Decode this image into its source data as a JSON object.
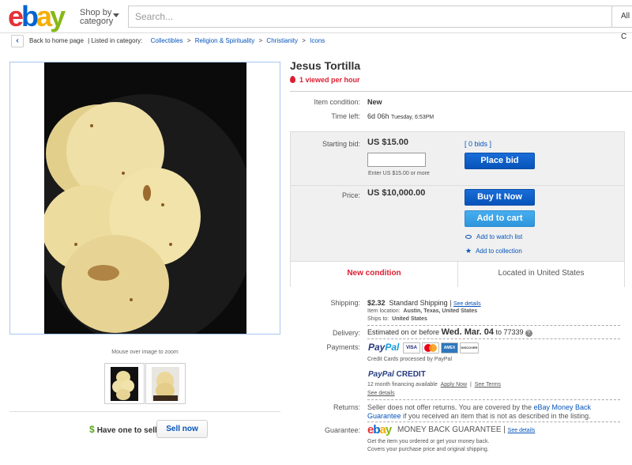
{
  "header": {
    "logo": {
      "e": "e",
      "b": "b",
      "a": "a",
      "y": "y"
    },
    "shop_by_line1": "Shop by",
    "shop_by_line2": "category",
    "search_placeholder": "Search...",
    "category_select": "All C"
  },
  "breadcrumb": {
    "back_label": "Back to home page",
    "listed_in": "| Listed in category:",
    "items": [
      "Collectibles",
      "Religion & Spirituality",
      "Christianity",
      "Icons"
    ],
    "separator": ">"
  },
  "gallery": {
    "zoom_hint": "Mouse over image to zoom",
    "sell_prompt": "Have one to sell?",
    "sell_dollar": "$",
    "sell_button": "Sell now"
  },
  "item": {
    "title": "Jesus Tortilla",
    "viewed": "1 viewed per hour",
    "condition_label": "Item condition:",
    "condition_value": "New",
    "time_left_label": "Time left:",
    "time_left_value": "6d 06h",
    "time_left_end": "Tuesday, 6:53PM"
  },
  "bidding": {
    "starting_bid_label": "Starting bid:",
    "starting_bid_value": "US $15.00",
    "bids_link": "[ 0 bids ]",
    "bid_hint": "Enter US $15.00 or more",
    "place_bid": "Place bid",
    "price_label": "Price:",
    "price_value": "US $10,000.00",
    "buy_now": "Buy It Now",
    "add_to_cart": "Add to cart",
    "watch_list": "Add to watch list",
    "collection": "Add to collection",
    "condition_badge": "New condition",
    "location_badge": "Located in United States"
  },
  "shipping": {
    "label": "Shipping:",
    "cost": "$2.32",
    "method": "Standard Shipping",
    "see_details": "See details",
    "location_label": "Item location:",
    "location_value": "Austin, Texas, United States",
    "ships_to_label": "Ships to:",
    "ships_to_value": "United States"
  },
  "delivery": {
    "label": "Delivery:",
    "prefix": "Estimated on or before",
    "date": "Wed. Mar. 04",
    "suffix": "to 77339",
    "info_icon": "?"
  },
  "payments": {
    "label": "Payments:",
    "paypal_1": "Pay",
    "paypal_2": "Pal",
    "cards": [
      "VISA",
      "MC",
      "AMEX",
      "DISCOVER"
    ],
    "processed": "Credit Cards processed by PayPal",
    "credit_1": "PayPal",
    "credit_2": "CREDIT",
    "financing": "12 month financing available",
    "apply_now": "Apply Now",
    "see_terms": "See Terms",
    "see_details": "See details"
  },
  "returns": {
    "label": "Returns:",
    "line1_a": "Seller does not offer returns. You are covered by the ",
    "line1_link": "eBay Money Back",
    "line2_link": "Guarantee",
    "line2_b": " if you received an item that is not as described in the listing."
  },
  "guarantee": {
    "label": "Guarantee:",
    "badge_text": "MONEY BACK GUARANTEE",
    "see_details": "See details",
    "line1": "Get the item you ordered or get your money back.",
    "line2": "Covers your purchase price and original shipping."
  },
  "colors": {
    "ebay_red": "#e53238",
    "ebay_blue": "#0064d2",
    "ebay_yellow": "#f5af02",
    "ebay_green": "#86b817",
    "link": "#0654ba",
    "alert_red": "#dd1e31"
  }
}
